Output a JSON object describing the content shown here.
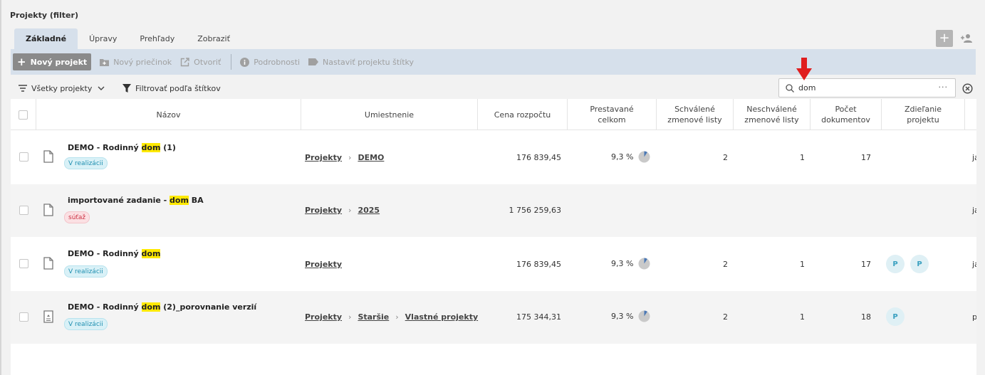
{
  "page": {
    "title": "Projekty (filter)"
  },
  "tabs": [
    {
      "label": "Základné",
      "active": true
    },
    {
      "label": "Úpravy",
      "active": false
    },
    {
      "label": "Prehľady",
      "active": false
    },
    {
      "label": "Zobraziť",
      "active": false
    }
  ],
  "top_right": {
    "add_icon": "plus-icon",
    "user_icon": "add-user-icon"
  },
  "toolbar": {
    "new_project": "Nový projekt",
    "new_folder": "Nový priečinok",
    "open": "Otvoriť",
    "details": "Podrobnosti",
    "set_tags": "Nastaviť projektu štítky"
  },
  "filterbar": {
    "all_projects": "Všetky projekty",
    "filter_by_tags": "Filtrovať podľa štítkov"
  },
  "search": {
    "value": "dom",
    "more": "···"
  },
  "columns": {
    "name": "Názov",
    "location": "Umiestnenie",
    "budget": "Cena rozpočtu",
    "built_total": [
      "Prestavané",
      "celkom"
    ],
    "approved": [
      "Schválené",
      "zmenové listy"
    ],
    "unapproved": [
      "Neschválené",
      "zmenové listy"
    ],
    "docs": [
      "Počet",
      "dokumentov"
    ],
    "sharing": [
      "Zdieľanie",
      "projektu"
    ]
  },
  "rows": [
    {
      "name_pre": "DEMO - Rodinný ",
      "name_hl": "dom",
      "name_post": " (1)",
      "badge": "V realizácii",
      "badge_color": "#1f8fb0",
      "location": [
        "Projekty",
        "DEMO"
      ],
      "budget": "176 839,45",
      "built": "9,3 %",
      "built_fraction": 0.093,
      "approved": "2",
      "unapproved": "1",
      "docs": "17",
      "sharing": [],
      "cut": "ja"
    },
    {
      "name_pre": "importované zadanie - ",
      "name_hl": "dom",
      "name_post": " BA",
      "badge": "súťaž",
      "badge_color": "#cc3344",
      "location": [
        "Projekty",
        "2025"
      ],
      "budget": "1 756 259,63",
      "built": "",
      "built_fraction": null,
      "approved": "",
      "unapproved": "",
      "docs": "",
      "sharing": [],
      "cut": "ja"
    },
    {
      "name_pre": "DEMO - Rodinný ",
      "name_hl": "dom",
      "name_post": "",
      "badge": "V realizácii",
      "badge_color": "#1f8fb0",
      "location": [
        "Projekty"
      ],
      "budget": "176 839,45",
      "built": "9,3 %",
      "built_fraction": 0.093,
      "approved": "2",
      "unapproved": "1",
      "docs": "17",
      "sharing": [
        "P",
        "P"
      ],
      "cut": "ja"
    },
    {
      "name_pre": "DEMO - Rodinný ",
      "name_hl": "dom",
      "name_post": " (2)_porovnanie verzií",
      "badge": "V realizácii",
      "badge_color": "#1f8fb0",
      "location": [
        "Projekty",
        "Staršie",
        "Vlastné projekty"
      ],
      "budget": "175 344,31",
      "built": "9,3 %",
      "built_fraction": 0.093,
      "approved": "2",
      "unapproved": "1",
      "docs": "18",
      "sharing": [
        "P"
      ],
      "cut": "pa"
    }
  ],
  "colors": {
    "accent_bar": "#d6e0eb",
    "highlight": "#ffe900",
    "arrow": "#e01e1e"
  }
}
